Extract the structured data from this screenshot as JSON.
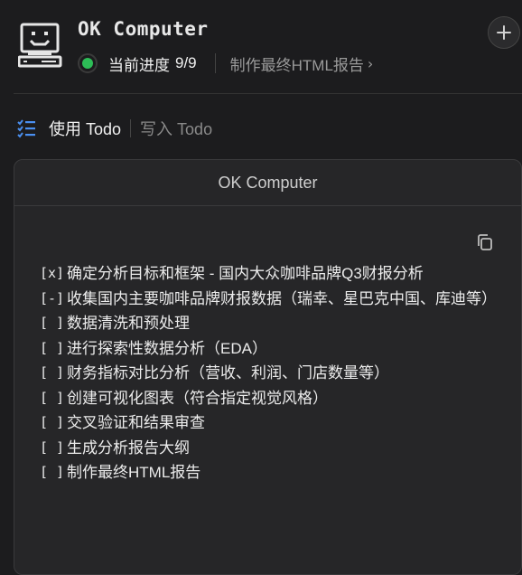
{
  "header": {
    "app_title": "OK Computer",
    "progress_label": "当前进度",
    "progress_value": "9/9",
    "current_step": "制作最终HTML报告",
    "status_color": "#2dbd57"
  },
  "tabs": {
    "active": "使用 Todo",
    "inactive": "写入 Todo"
  },
  "card": {
    "title": "OK Computer",
    "todos": [
      {
        "mark": "[x]",
        "text": "确定分析目标和框架 - 国内大众咖啡品牌Q3财报分析"
      },
      {
        "mark": "[-]",
        "text": "收集国内主要咖啡品牌财报数据（瑞幸、星巴克中国、库迪等）"
      },
      {
        "mark": "[ ]",
        "text": "数据清洗和预处理"
      },
      {
        "mark": "[ ]",
        "text": "进行探索性数据分析（EDA）"
      },
      {
        "mark": "[ ]",
        "text": "财务指标对比分析（营收、利润、门店数量等）"
      },
      {
        "mark": "[ ]",
        "text": "创建可视化图表（符合指定视觉风格）"
      },
      {
        "mark": "[ ]",
        "text": "交叉验证和结果审查"
      },
      {
        "mark": "[ ]",
        "text": "生成分析报告大纲"
      },
      {
        "mark": "[ ]",
        "text": "制作最终HTML报告"
      }
    ]
  },
  "icons": {
    "logo": "computer-face-icon",
    "plus": "plus-icon",
    "todo": "checklist-icon",
    "copy": "copy-icon",
    "chevron": "chevron-right-icon"
  }
}
